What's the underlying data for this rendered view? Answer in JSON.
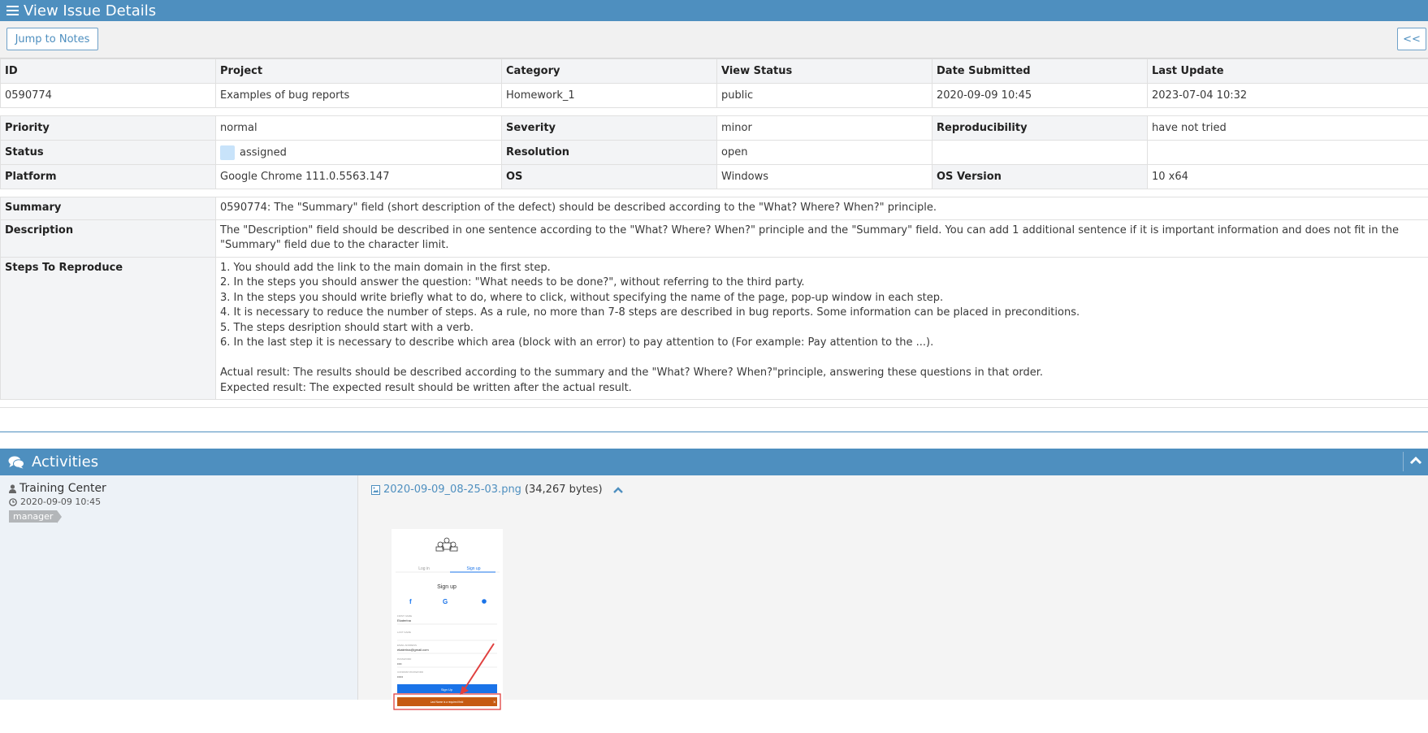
{
  "header": {
    "title": "View Issue Details"
  },
  "toolbar": {
    "jump_label": "Jump to Notes",
    "collapse_label": "<<"
  },
  "fields": {
    "headers": [
      "ID",
      "Project",
      "Category",
      "View Status",
      "Date Submitted",
      "Last Update"
    ],
    "values": [
      "0590774",
      "Examples of bug reports",
      "Homework_1",
      "public",
      "2020-09-09 10:45",
      "2023-07-04 10:32"
    ]
  },
  "details": {
    "priority_label": "Priority",
    "priority": "normal",
    "severity_label": "Severity",
    "severity": "minor",
    "repro_label": "Reproducibility",
    "repro": "have not tried",
    "status_label": "Status",
    "status": "assigned",
    "resolution_label": "Resolution",
    "resolution": "open",
    "platform_label": "Platform",
    "platform": "Google Chrome 111.0.5563.147",
    "os_label": "OS",
    "os": "Windows",
    "osver_label": "OS Version",
    "osver": "10 x64",
    "status_color": "#c8e3fa"
  },
  "info": {
    "summary_label": "Summary",
    "summary": "0590774: The \"Summary\" field (short description of the defect) should be described according to the \"What? Where? When?\" principle.",
    "description_label": "Description",
    "description": "The \"Description\" field should be described in one sentence according to the \"What? Where? When?\" principle and the \"Summary\" field. You can add 1 additional sentence if it is important information and does not fit in the \"Summary\" field due to the character limit.",
    "steps_label": "Steps To Reproduce",
    "steps": [
      "1. You should add the link to the main domain in the first step.",
      "2. In the steps you should answer the question: \"What needs to be done?\", without referring to the third party.",
      "3. In the steps you should write briefly what to do, where to click, without specifying the name of the page, pop-up window in each step.",
      "4. It is necessary to reduce the number of steps. As a rule, no more than 7-8 steps are described in bug reports. Some information can be placed in preconditions.",
      "5. The steps desription should start with a verb.",
      "6. In the last step it is necessary to describe which area (block with an error) to pay attention to (For example: Pay attention to the ...).",
      "",
      "Actual result: The results should be described according to the summary and the \"What? Where? When?\"principle, answering these questions in that order.",
      "Expected result: The expected result should be written after the actual result."
    ]
  },
  "activities": {
    "title": "Activities",
    "user": "Training Center",
    "timestamp": "2020-09-09 10:45",
    "role": "manager",
    "file_name": "2020-09-09_08-25-03.png",
    "file_size": "(34,267 bytes)"
  },
  "thumbnail": {
    "tab_login": "Log in",
    "tab_signup": "Sign up",
    "heading": "Sign up",
    "field1_label": "FIRST NAME",
    "field1_value": "Ekaterina",
    "field2_label": "LAST NAME",
    "field3_label": "EMAIL ADDRESS",
    "field3_value": "ekaterina@gmail.com",
    "field4_label": "PASSWORD",
    "field4_value": "••••",
    "field5_label": "CONFIRM PASSWORD",
    "field5_value": "•••••",
    "button": "Sign Up",
    "error": "Last Name is a required field",
    "error_close": "×"
  },
  "colors": {
    "accent": "#4e8fbf",
    "error": "#c65a11",
    "highlight": "#e0403f"
  }
}
